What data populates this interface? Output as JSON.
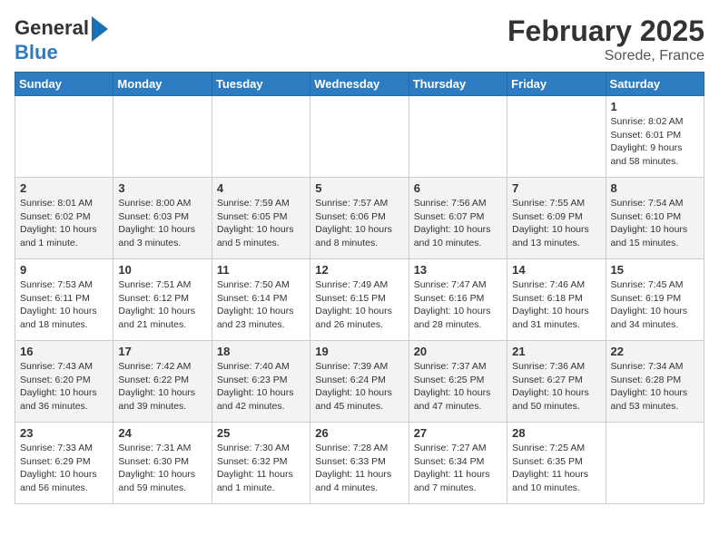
{
  "header": {
    "logo_line1": "General",
    "logo_line2": "Blue",
    "title": "February 2025",
    "subtitle": "Sorede, France"
  },
  "weekdays": [
    "Sunday",
    "Monday",
    "Tuesday",
    "Wednesday",
    "Thursday",
    "Friday",
    "Saturday"
  ],
  "weeks": [
    [
      {
        "day": "",
        "text": ""
      },
      {
        "day": "",
        "text": ""
      },
      {
        "day": "",
        "text": ""
      },
      {
        "day": "",
        "text": ""
      },
      {
        "day": "",
        "text": ""
      },
      {
        "day": "",
        "text": ""
      },
      {
        "day": "1",
        "text": "Sunrise: 8:02 AM\nSunset: 6:01 PM\nDaylight: 9 hours and 58 minutes."
      }
    ],
    [
      {
        "day": "2",
        "text": "Sunrise: 8:01 AM\nSunset: 6:02 PM\nDaylight: 10 hours and 1 minute."
      },
      {
        "day": "3",
        "text": "Sunrise: 8:00 AM\nSunset: 6:03 PM\nDaylight: 10 hours and 3 minutes."
      },
      {
        "day": "4",
        "text": "Sunrise: 7:59 AM\nSunset: 6:05 PM\nDaylight: 10 hours and 5 minutes."
      },
      {
        "day": "5",
        "text": "Sunrise: 7:57 AM\nSunset: 6:06 PM\nDaylight: 10 hours and 8 minutes."
      },
      {
        "day": "6",
        "text": "Sunrise: 7:56 AM\nSunset: 6:07 PM\nDaylight: 10 hours and 10 minutes."
      },
      {
        "day": "7",
        "text": "Sunrise: 7:55 AM\nSunset: 6:09 PM\nDaylight: 10 hours and 13 minutes."
      },
      {
        "day": "8",
        "text": "Sunrise: 7:54 AM\nSunset: 6:10 PM\nDaylight: 10 hours and 15 minutes."
      }
    ],
    [
      {
        "day": "9",
        "text": "Sunrise: 7:53 AM\nSunset: 6:11 PM\nDaylight: 10 hours and 18 minutes."
      },
      {
        "day": "10",
        "text": "Sunrise: 7:51 AM\nSunset: 6:12 PM\nDaylight: 10 hours and 21 minutes."
      },
      {
        "day": "11",
        "text": "Sunrise: 7:50 AM\nSunset: 6:14 PM\nDaylight: 10 hours and 23 minutes."
      },
      {
        "day": "12",
        "text": "Sunrise: 7:49 AM\nSunset: 6:15 PM\nDaylight: 10 hours and 26 minutes."
      },
      {
        "day": "13",
        "text": "Sunrise: 7:47 AM\nSunset: 6:16 PM\nDaylight: 10 hours and 28 minutes."
      },
      {
        "day": "14",
        "text": "Sunrise: 7:46 AM\nSunset: 6:18 PM\nDaylight: 10 hours and 31 minutes."
      },
      {
        "day": "15",
        "text": "Sunrise: 7:45 AM\nSunset: 6:19 PM\nDaylight: 10 hours and 34 minutes."
      }
    ],
    [
      {
        "day": "16",
        "text": "Sunrise: 7:43 AM\nSunset: 6:20 PM\nDaylight: 10 hours and 36 minutes."
      },
      {
        "day": "17",
        "text": "Sunrise: 7:42 AM\nSunset: 6:22 PM\nDaylight: 10 hours and 39 minutes."
      },
      {
        "day": "18",
        "text": "Sunrise: 7:40 AM\nSunset: 6:23 PM\nDaylight: 10 hours and 42 minutes."
      },
      {
        "day": "19",
        "text": "Sunrise: 7:39 AM\nSunset: 6:24 PM\nDaylight: 10 hours and 45 minutes."
      },
      {
        "day": "20",
        "text": "Sunrise: 7:37 AM\nSunset: 6:25 PM\nDaylight: 10 hours and 47 minutes."
      },
      {
        "day": "21",
        "text": "Sunrise: 7:36 AM\nSunset: 6:27 PM\nDaylight: 10 hours and 50 minutes."
      },
      {
        "day": "22",
        "text": "Sunrise: 7:34 AM\nSunset: 6:28 PM\nDaylight: 10 hours and 53 minutes."
      }
    ],
    [
      {
        "day": "23",
        "text": "Sunrise: 7:33 AM\nSunset: 6:29 PM\nDaylight: 10 hours and 56 minutes."
      },
      {
        "day": "24",
        "text": "Sunrise: 7:31 AM\nSunset: 6:30 PM\nDaylight: 10 hours and 59 minutes."
      },
      {
        "day": "25",
        "text": "Sunrise: 7:30 AM\nSunset: 6:32 PM\nDaylight: 11 hours and 1 minute."
      },
      {
        "day": "26",
        "text": "Sunrise: 7:28 AM\nSunset: 6:33 PM\nDaylight: 11 hours and 4 minutes."
      },
      {
        "day": "27",
        "text": "Sunrise: 7:27 AM\nSunset: 6:34 PM\nDaylight: 11 hours and 7 minutes."
      },
      {
        "day": "28",
        "text": "Sunrise: 7:25 AM\nSunset: 6:35 PM\nDaylight: 11 hours and 10 minutes."
      },
      {
        "day": "",
        "text": ""
      }
    ]
  ]
}
